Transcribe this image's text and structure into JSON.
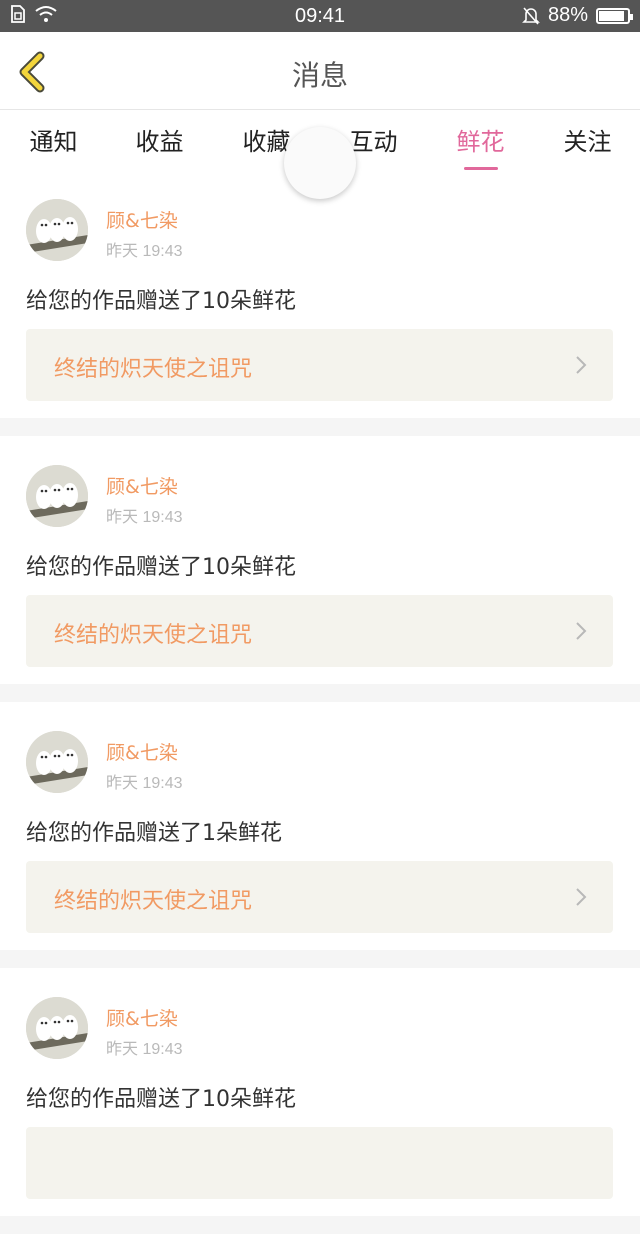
{
  "status_bar": {
    "time": "09:41",
    "battery": "88%",
    "battery_level": 0.88
  },
  "header": {
    "title": "消息",
    "back_icon": "chevron-left-icon"
  },
  "tabs": [
    {
      "label": "通知",
      "active": false
    },
    {
      "label": "收益",
      "active": false
    },
    {
      "label": "收藏",
      "active": false
    },
    {
      "label": "互动",
      "active": false
    },
    {
      "label": "鲜花",
      "active": true
    },
    {
      "label": "关注",
      "active": false
    }
  ],
  "colors": {
    "accent": "#e1689b",
    "name": "#f19a63",
    "status_bar": "#555555",
    "card_inner": "#f4f3ed"
  },
  "messages": [
    {
      "user": "顾&七染",
      "time": "昨天 19:43",
      "text": "给您的作品赠送了10朵鲜花",
      "work": "终结的炽天使之诅咒"
    },
    {
      "user": "顾&七染",
      "time": "昨天 19:43",
      "text": "给您的作品赠送了10朵鲜花",
      "work": "终结的炽天使之诅咒"
    },
    {
      "user": "顾&七染",
      "time": "昨天 19:43",
      "text": "给您的作品赠送了1朵鲜花",
      "work": "终结的炽天使之诅咒"
    },
    {
      "user": "顾&七染",
      "time": "昨天 19:43",
      "text": "给您的作品赠送了10朵鲜花",
      "work": ""
    }
  ]
}
